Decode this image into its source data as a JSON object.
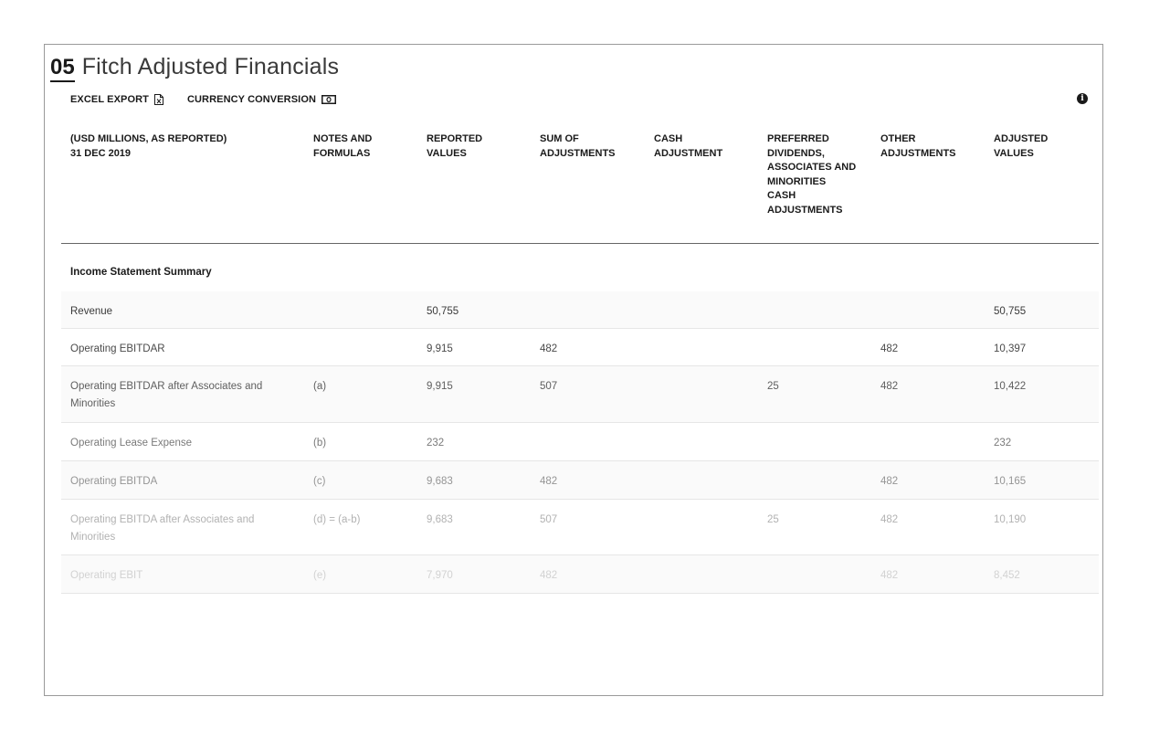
{
  "section": {
    "number": "05",
    "title": "Fitch Adjusted Financials"
  },
  "toolbar": {
    "excel_export": "EXCEL EXPORT",
    "currency_conversion": "CURRENCY CONVERSION"
  },
  "table": {
    "header_lines": {
      "col0": [
        "(USD MILLIONS, AS REPORTED)",
        "31 DEC 2019"
      ],
      "col1": [
        "NOTES AND",
        "FORMULAS"
      ],
      "col2": [
        "REPORTED",
        "VALUES"
      ],
      "col3": [
        "SUM OF",
        "ADJUSTMENTS"
      ],
      "col4": [
        "CASH",
        "ADJUSTMENT"
      ],
      "col5": [
        "PREFERRED",
        "DIVIDENDS,",
        "ASSOCIATES AND",
        "MINORITIES",
        "CASH",
        "ADJUSTMENTS"
      ],
      "col6": [
        "OTHER",
        "ADJUSTMENTS"
      ],
      "col7": [
        "ADJUSTED",
        "VALUES"
      ]
    },
    "section_label": "Income Statement Summary",
    "rows": [
      {
        "label": "Revenue",
        "note": "",
        "reported": "50,755",
        "sum_adj": "",
        "cash_adj": "",
        "pref_adj": "",
        "other_adj": "",
        "adjusted": "50,755"
      },
      {
        "label": "Operating EBITDAR",
        "note": "",
        "reported": "9,915",
        "sum_adj": "482",
        "cash_adj": "",
        "pref_adj": "",
        "other_adj": "482",
        "adjusted": "10,397"
      },
      {
        "label": "Operating EBITDAR after Associates and Minorities",
        "note": "(a)",
        "reported": "9,915",
        "sum_adj": "507",
        "cash_adj": "",
        "pref_adj": "25",
        "other_adj": "482",
        "adjusted": "10,422"
      },
      {
        "label": "Operating Lease Expense",
        "note": "(b)",
        "reported": "232",
        "sum_adj": "",
        "cash_adj": "",
        "pref_adj": "",
        "other_adj": "",
        "adjusted": "232"
      },
      {
        "label": "Operating EBITDA",
        "note": "(c)",
        "reported": "9,683",
        "sum_adj": "482",
        "cash_adj": "",
        "pref_adj": "",
        "other_adj": "482",
        "adjusted": "10,165"
      },
      {
        "label": "Operating EBITDA after Associates and Minorities",
        "note": "(d) = (a-b)",
        "reported": "9,683",
        "sum_adj": "507",
        "cash_adj": "",
        "pref_adj": "25",
        "other_adj": "482",
        "adjusted": "10,190"
      },
      {
        "label": "Operating EBIT",
        "note": "(e)",
        "reported": "7,970",
        "sum_adj": "482",
        "cash_adj": "",
        "pref_adj": "",
        "other_adj": "482",
        "adjusted": "8,452"
      }
    ],
    "row_text_colors": [
      "#3a3a3a",
      "#4a4a4a",
      "#5e5e5e",
      "#7a7a7a",
      "#959595",
      "#b2b2b2",
      "#d2d2d2"
    ]
  }
}
